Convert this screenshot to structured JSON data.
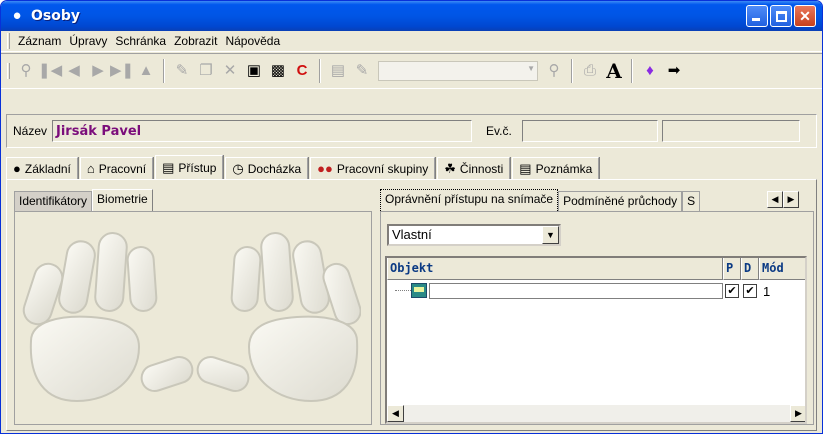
{
  "window": {
    "title": "Osoby",
    "accent": "#0055e5",
    "buttons": [
      "minimize",
      "maximize",
      "close"
    ]
  },
  "menu": [
    "Záznam",
    "Úpravy",
    "Schránka",
    "Zobrazit",
    "Nápověda"
  ],
  "toolbar": {
    "icons": [
      "search-icon",
      "first-icon",
      "prev-icon",
      "next-icon",
      "last-icon",
      "stamp-icon",
      "new-icon",
      "copy-icon",
      "delete-icon",
      "save-icon",
      "save-all-icon",
      "refresh-icon",
      "list-icon",
      "filter-icon",
      "find-icon",
      "print-icon",
      "font-icon",
      "book-icon",
      "exit-icon"
    ],
    "combo_value": ""
  },
  "header": {
    "name_label": "Název",
    "name_value": "Jirsák Pavel",
    "evc_label": "Ev.č.",
    "evc_value": "",
    "extra_value": ""
  },
  "tabs": [
    {
      "label": "Základní",
      "icon": "person-icon"
    },
    {
      "label": "Pracovní",
      "icon": "house-icon"
    },
    {
      "label": "Přístup",
      "icon": "card-icon",
      "active": true
    },
    {
      "label": "Docházka",
      "icon": "clock-person-icon"
    },
    {
      "label": "Pracovní skupiny",
      "icon": "group-icon"
    },
    {
      "label": "Činnosti",
      "icon": "activity-icon"
    },
    {
      "label": "Poznámka",
      "icon": "note-icon"
    }
  ],
  "left_subtabs": [
    {
      "label": "Identifikátory"
    },
    {
      "label": "Biometrie",
      "active": true
    }
  ],
  "right_subtabs": [
    {
      "label": "Oprávnění přístupu na snímače",
      "active": true
    },
    {
      "label": "Podmíněné průchody"
    },
    {
      "label": "S"
    }
  ],
  "access": {
    "combo_value": "Vlastní",
    "columns": [
      "Objekt",
      "P",
      "D",
      "Mód"
    ],
    "rows": [
      {
        "objekt": "",
        "p": true,
        "d": true,
        "mod": "1"
      }
    ]
  }
}
